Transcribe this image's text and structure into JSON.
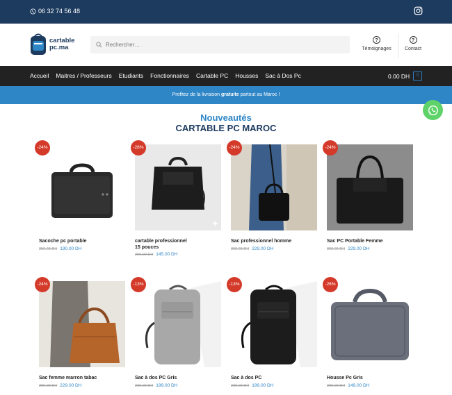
{
  "topbar": {
    "phone": "06 32 74 56 48",
    "social_icon": "instagram-icon"
  },
  "header": {
    "logo_line1": "cartable",
    "logo_line2": "pc.ma",
    "search_placeholder": "Rechercher…",
    "testimonials_label": "Témoignages",
    "contact_label": "Contact"
  },
  "nav": {
    "items": [
      "Accueil",
      "Maitres / Professeurs",
      "Etudiants",
      "Fonctionnaires",
      "Cartable PC",
      "Housses",
      "Sac à Dos Pc"
    ],
    "cart_total": "0.00 DH",
    "cart_count": "0"
  },
  "promo": {
    "before": "Profitez de la livraison",
    "bold": "gratuite",
    "after": "partout au Maroc !"
  },
  "section": {
    "kicker": "Nouveautés",
    "title": "CARTABLE PC MAROC"
  },
  "products": [
    {
      "badge": "-24%",
      "name": "Sacoche pc portable",
      "name2": "",
      "old": "250.00 DH",
      "price": "190.00 DH"
    },
    {
      "badge": "-28%",
      "name": "cartable professionnel",
      "name2": "15 pouces",
      "old": "200.00 DH",
      "price": "145.00 DH"
    },
    {
      "badge": "-24%",
      "name": "Sac professionnel homme",
      "name2": "",
      "old": "300.00 DH",
      "price": "229.00 DH"
    },
    {
      "badge": "-24%",
      "name": "Sac PC Portable Femme",
      "name2": "",
      "old": "300.00 DH",
      "price": "229.00 DH"
    },
    {
      "badge": "-24%",
      "name": "Sac femme marron tabac",
      "name2": "",
      "old": "300.00 DH",
      "price": "229.00 DH"
    },
    {
      "badge": "-13%",
      "name": "Sac à dos PC Gris",
      "name2": "",
      "old": "230.00 DH",
      "price": "199.00 DH"
    },
    {
      "badge": "-13%",
      "name": "Sac à dos PC",
      "name2": "",
      "old": "230.00 DH",
      "price": "199.00 DH"
    },
    {
      "badge": "-26%",
      "name": "Housse Pc Gris",
      "name2": "",
      "old": "200.00 DH",
      "price": "149.00 DH"
    }
  ],
  "colors": {
    "topbar": "#1d3b5f",
    "accent": "#2e86c6",
    "sale_badge": "#d43a2a",
    "whatsapp": "#5fd36a"
  }
}
